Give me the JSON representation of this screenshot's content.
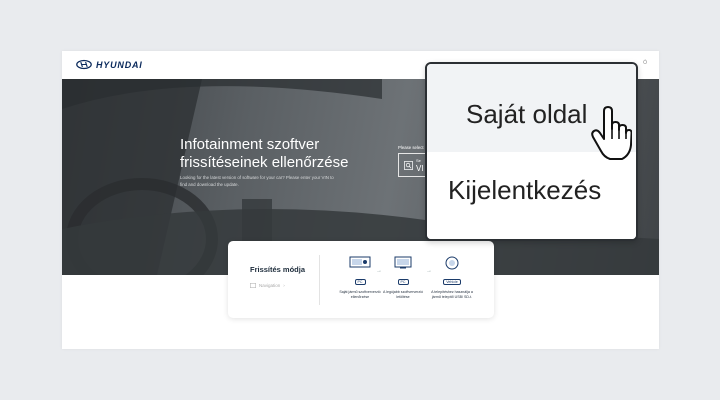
{
  "brand": {
    "logo_text": "HYUNDAI"
  },
  "header": {
    "right_text": "Ó"
  },
  "hero": {
    "title": "Infotainment szoftver frissítéseinek ellenőrzése",
    "subtitle": "Looking for the latest version of software for your car? Please enter your VIN to find and download the update.",
    "select_label": "Please select",
    "select_small": "Se",
    "select_value": "VI"
  },
  "card": {
    "title": "Frissítés módja",
    "nav_label": "Navigation",
    "steps": [
      {
        "tag": "PC",
        "text": "Saját jármű szoftververzió ellenőrzése"
      },
      {
        "tag": "PC",
        "text": "A legújabb szoftververzió letöltése"
      },
      {
        "tag": "Vehicle",
        "text": "A telepítéshez használja a jármű telepítő USB/ SD-t."
      }
    ]
  },
  "popup": {
    "items": [
      {
        "label": "Saját oldal"
      },
      {
        "label": "Kijelentkezés"
      }
    ]
  },
  "colors": {
    "brand_blue": "#0b2a5c",
    "accent": "#1b3b6a"
  }
}
